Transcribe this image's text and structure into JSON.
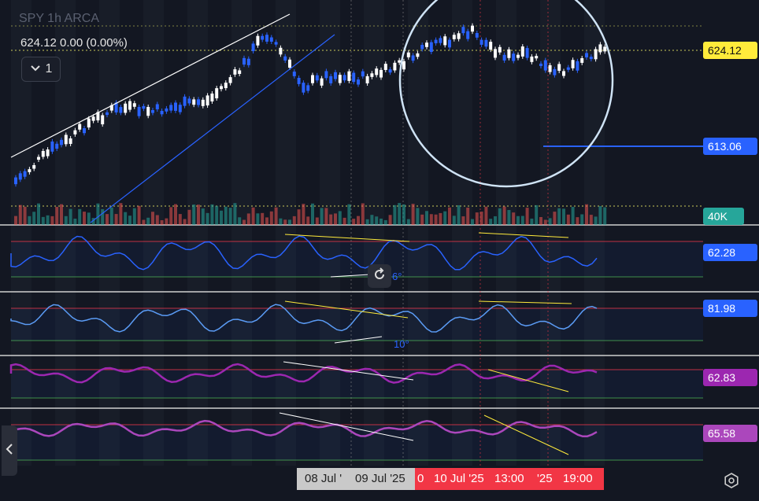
{
  "header": {
    "symbol": "SPY 1h ARCA",
    "ohlc_line": "624.12  0.00 (0.00%)",
    "layout_toggle": "1"
  },
  "price_axis": {
    "current_price": "624.12",
    "line_price": "613.06",
    "volume": "40K"
  },
  "indicators": [
    {
      "value": "62.28",
      "color": "#2962ff"
    },
    {
      "value": "81.98",
      "color": "#2962ff"
    },
    {
      "value": "62.83",
      "color": "#9c27b0"
    },
    {
      "value": "65.58",
      "color": "#ab47bc"
    }
  ],
  "angle_labels": [
    "6°",
    "10°"
  ],
  "time_axis": {
    "labels": [
      "08 Jul '",
      "09 Jul '25",
      "0",
      "10 Jul '25",
      "13:00",
      "'25",
      "19:00"
    ]
  },
  "colors": {
    "background": "#131722",
    "up": "#ffffff",
    "down": "#2962ff",
    "yellow_tag": "#ffeb3b",
    "blue_tag": "#2962ff",
    "green_tag": "#26a69a",
    "purple": "#9c27b0",
    "red_axis": "#f23645"
  },
  "icons": [
    "chevron-down-icon",
    "reset-icon",
    "chevron-left-icon",
    "settings-icon"
  ]
}
